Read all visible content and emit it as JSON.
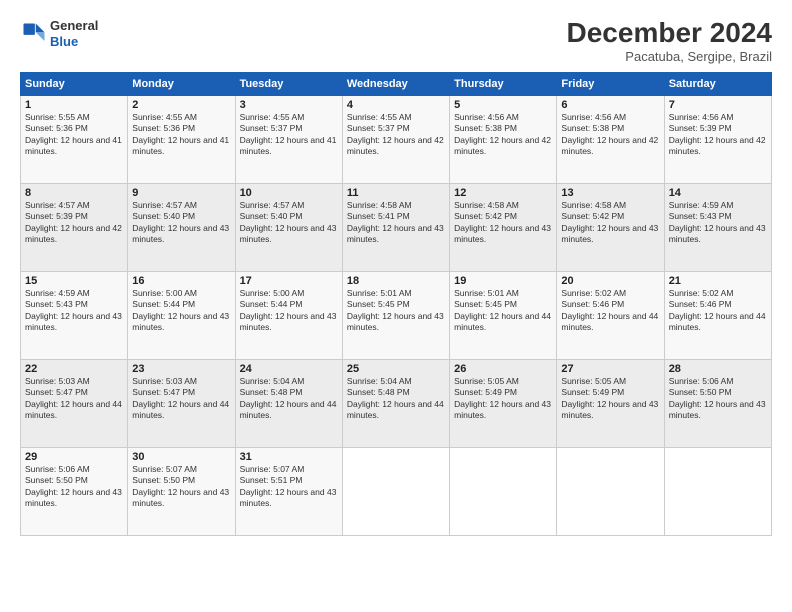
{
  "logo": {
    "line1": "General",
    "line2": "Blue"
  },
  "title": "December 2024",
  "subtitle": "Pacatuba, Sergipe, Brazil",
  "days_of_week": [
    "Sunday",
    "Monday",
    "Tuesday",
    "Wednesday",
    "Thursday",
    "Friday",
    "Saturday"
  ],
  "weeks": [
    [
      {
        "day": 1,
        "sunrise": "5:55 AM",
        "sunset": "5:36 PM",
        "daylight": "12 hours and 41 minutes."
      },
      {
        "day": 2,
        "sunrise": "4:55 AM",
        "sunset": "5:36 PM",
        "daylight": "12 hours and 41 minutes."
      },
      {
        "day": 3,
        "sunrise": "4:55 AM",
        "sunset": "5:37 PM",
        "daylight": "12 hours and 41 minutes."
      },
      {
        "day": 4,
        "sunrise": "4:55 AM",
        "sunset": "5:37 PM",
        "daylight": "12 hours and 42 minutes."
      },
      {
        "day": 5,
        "sunrise": "4:56 AM",
        "sunset": "5:38 PM",
        "daylight": "12 hours and 42 minutes."
      },
      {
        "day": 6,
        "sunrise": "4:56 AM",
        "sunset": "5:38 PM",
        "daylight": "12 hours and 42 minutes."
      },
      {
        "day": 7,
        "sunrise": "4:56 AM",
        "sunset": "5:39 PM",
        "daylight": "12 hours and 42 minutes."
      }
    ],
    [
      {
        "day": 8,
        "sunrise": "4:57 AM",
        "sunset": "5:39 PM",
        "daylight": "12 hours and 42 minutes."
      },
      {
        "day": 9,
        "sunrise": "4:57 AM",
        "sunset": "5:40 PM",
        "daylight": "12 hours and 43 minutes."
      },
      {
        "day": 10,
        "sunrise": "4:57 AM",
        "sunset": "5:40 PM",
        "daylight": "12 hours and 43 minutes."
      },
      {
        "day": 11,
        "sunrise": "4:58 AM",
        "sunset": "5:41 PM",
        "daylight": "12 hours and 43 minutes."
      },
      {
        "day": 12,
        "sunrise": "4:58 AM",
        "sunset": "5:42 PM",
        "daylight": "12 hours and 43 minutes."
      },
      {
        "day": 13,
        "sunrise": "4:58 AM",
        "sunset": "5:42 PM",
        "daylight": "12 hours and 43 minutes."
      },
      {
        "day": 14,
        "sunrise": "4:59 AM",
        "sunset": "5:43 PM",
        "daylight": "12 hours and 43 minutes."
      }
    ],
    [
      {
        "day": 15,
        "sunrise": "4:59 AM",
        "sunset": "5:43 PM",
        "daylight": "12 hours and 43 minutes."
      },
      {
        "day": 16,
        "sunrise": "5:00 AM",
        "sunset": "5:44 PM",
        "daylight": "12 hours and 43 minutes."
      },
      {
        "day": 17,
        "sunrise": "5:00 AM",
        "sunset": "5:44 PM",
        "daylight": "12 hours and 43 minutes."
      },
      {
        "day": 18,
        "sunrise": "5:01 AM",
        "sunset": "5:45 PM",
        "daylight": "12 hours and 43 minutes."
      },
      {
        "day": 19,
        "sunrise": "5:01 AM",
        "sunset": "5:45 PM",
        "daylight": "12 hours and 44 minutes."
      },
      {
        "day": 20,
        "sunrise": "5:02 AM",
        "sunset": "5:46 PM",
        "daylight": "12 hours and 44 minutes."
      },
      {
        "day": 21,
        "sunrise": "5:02 AM",
        "sunset": "5:46 PM",
        "daylight": "12 hours and 44 minutes."
      }
    ],
    [
      {
        "day": 22,
        "sunrise": "5:03 AM",
        "sunset": "5:47 PM",
        "daylight": "12 hours and 44 minutes."
      },
      {
        "day": 23,
        "sunrise": "5:03 AM",
        "sunset": "5:47 PM",
        "daylight": "12 hours and 44 minutes."
      },
      {
        "day": 24,
        "sunrise": "5:04 AM",
        "sunset": "5:48 PM",
        "daylight": "12 hours and 44 minutes."
      },
      {
        "day": 25,
        "sunrise": "5:04 AM",
        "sunset": "5:48 PM",
        "daylight": "12 hours and 44 minutes."
      },
      {
        "day": 26,
        "sunrise": "5:05 AM",
        "sunset": "5:49 PM",
        "daylight": "12 hours and 43 minutes."
      },
      {
        "day": 27,
        "sunrise": "5:05 AM",
        "sunset": "5:49 PM",
        "daylight": "12 hours and 43 minutes."
      },
      {
        "day": 28,
        "sunrise": "5:06 AM",
        "sunset": "5:50 PM",
        "daylight": "12 hours and 43 minutes."
      }
    ],
    [
      {
        "day": 29,
        "sunrise": "5:06 AM",
        "sunset": "5:50 PM",
        "daylight": "12 hours and 43 minutes."
      },
      {
        "day": 30,
        "sunrise": "5:07 AM",
        "sunset": "5:50 PM",
        "daylight": "12 hours and 43 minutes."
      },
      {
        "day": 31,
        "sunrise": "5:07 AM",
        "sunset": "5:51 PM",
        "daylight": "12 hours and 43 minutes."
      },
      null,
      null,
      null,
      null
    ]
  ]
}
